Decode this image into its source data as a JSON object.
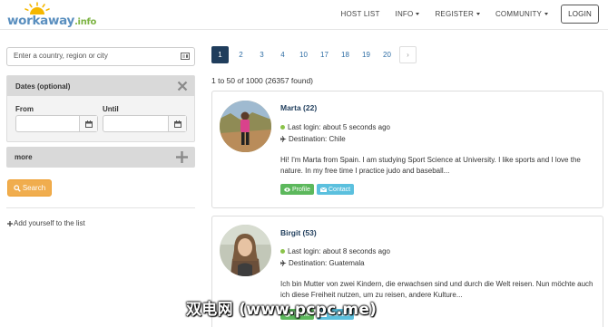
{
  "header": {
    "logo_text": "workaway",
    "logo_tld": ".info",
    "nav": {
      "host_list": "HOST LIST",
      "info": "INFO",
      "register": "REGISTER",
      "community": "COMMUNITY",
      "login": "LOGIN"
    }
  },
  "sidebar": {
    "search_placeholder": "Enter a country, region or city",
    "dates_title": "Dates (optional)",
    "from_label": "From",
    "until_label": "Until",
    "more_label": "more",
    "search_button": "Search",
    "add_yourself": "Add yourself to the list"
  },
  "pagination": {
    "pages": [
      "1",
      "2",
      "3",
      "4",
      "10",
      "17",
      "18",
      "19",
      "20"
    ],
    "next": "›",
    "results_text": "1 to 50 of 1000 (26357 found)"
  },
  "profiles": [
    {
      "name": "Marta (22)",
      "last_login": "Last login: about 5 seconds ago",
      "destination": "Destination: Chile",
      "bio": "Hi! I'm Marta from Spain. I am studying Sport Science at University. I like sports and I love the nature. In my free time I practice judo and baseball...",
      "profile_btn": "Profile",
      "contact_btn": "Contact"
    },
    {
      "name": "Birgit (53)",
      "last_login": "Last login: about 8 seconds ago",
      "destination": "Destination: Guatemala",
      "bio": "Ich bin Mutter von zwei Kindern, die erwachsen sind und durch die Welt reisen. Nun möchte auch ich diese Freiheit nutzen, um zu reisen, andere Kulture...",
      "profile_btn": "Profile",
      "contact_btn": "Contact"
    }
  ],
  "watermark": "双电网 (www.pcpc.me)",
  "colors": {
    "active_page": "#1f3d5c",
    "search_button": "#f0ad4e",
    "profile_button": "#5cb85c",
    "contact_button": "#5bc0de",
    "online_dot": "#8bc34a"
  }
}
